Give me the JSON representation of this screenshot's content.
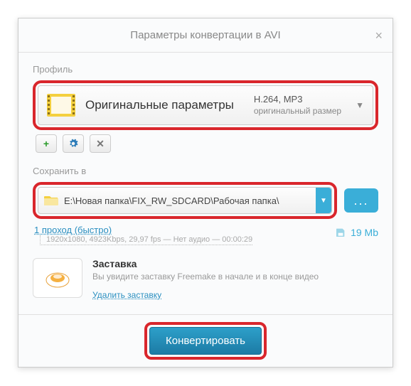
{
  "dialog": {
    "title": "Параметры конвертации в AVI"
  },
  "profile": {
    "section_label": "Профиль",
    "name": "Оригинальные параметры",
    "codec": "H.264, MP3",
    "size_mode": "оригинальный размер"
  },
  "save": {
    "section_label": "Сохранить в",
    "path": "E:\\Новая папка\\FIX_RW_SDCARD\\Рабочая папка\\",
    "browse_label": "..."
  },
  "pass": {
    "link_text": "1 проход (быстро)",
    "details": "1920x1080, 4923Kbps, 29,97 fps — Нет аудио — 00:00:29",
    "est_size": "19 Mb"
  },
  "splash": {
    "title": "Заставка",
    "desc": "Вы увидите заставку Freemake в начале и в конце видео",
    "remove_link": "Удалить заставку"
  },
  "footer": {
    "convert_label": "Конвертировать"
  }
}
